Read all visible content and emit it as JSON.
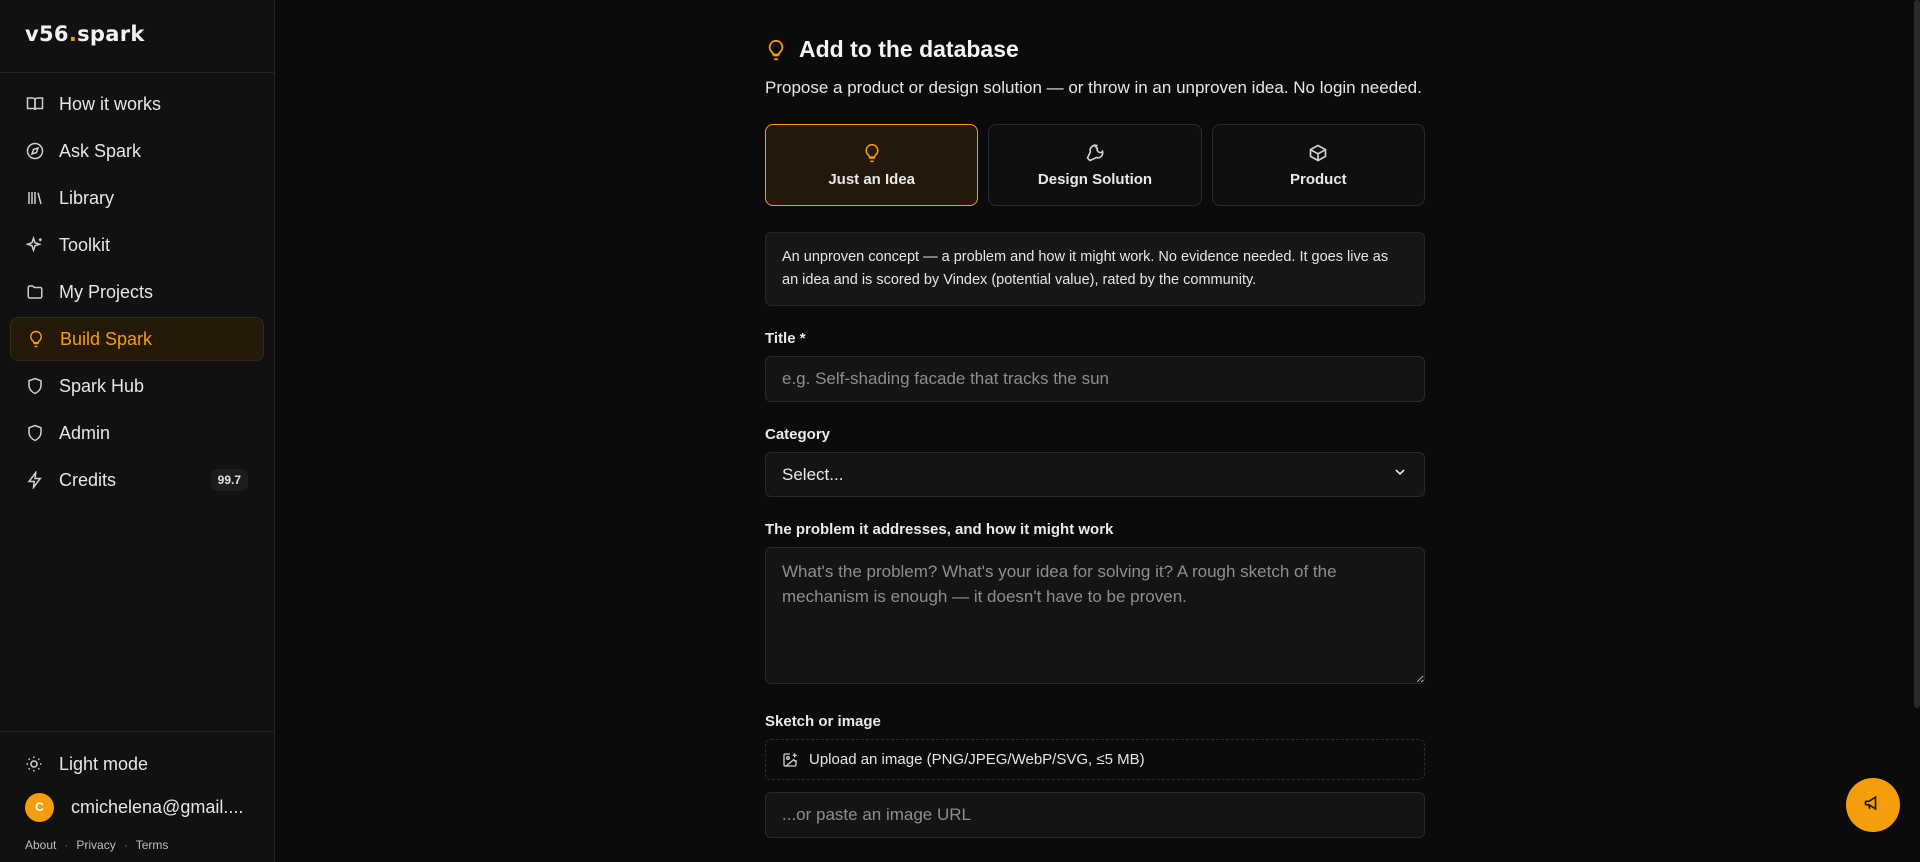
{
  "app": {
    "logo_prefix": "v56",
    "logo_dot": ".",
    "logo_suffix": "spark"
  },
  "sidebar": {
    "items": [
      {
        "label": "How it works",
        "icon": "book-icon"
      },
      {
        "label": "Ask Spark",
        "icon": "compass-icon"
      },
      {
        "label": "Library",
        "icon": "library-icon"
      },
      {
        "label": "Toolkit",
        "icon": "sparkles-icon"
      },
      {
        "label": "My Projects",
        "icon": "folder-icon"
      },
      {
        "label": "Build Spark",
        "icon": "lightbulb-icon",
        "active": true
      },
      {
        "label": "Spark Hub",
        "icon": "shield-icon"
      },
      {
        "label": "Admin",
        "icon": "shield-icon"
      },
      {
        "label": "Credits",
        "icon": "bolt-icon",
        "badge": "99.7"
      }
    ],
    "theme_label": "Light mode",
    "user": {
      "initial": "C",
      "email": "cmichelena@gmail...."
    },
    "footer": [
      "About",
      "Privacy",
      "Terms"
    ]
  },
  "main": {
    "title": "Add to the database",
    "subtitle": "Propose a product or design solution — or throw in an unproven idea. No login needed.",
    "types": [
      {
        "label": "Just an Idea",
        "icon": "lightbulb-icon",
        "active": true
      },
      {
        "label": "Design Solution",
        "icon": "wrench-icon"
      },
      {
        "label": "Product",
        "icon": "box-icon"
      }
    ],
    "info": "An unproven concept — a problem and how it might work. No evidence needed. It goes live as an idea and is scored by Vindex (potential value), rated by the community.",
    "title_field": {
      "label": "Title *",
      "placeholder": "e.g. Self-shading facade that tracks the sun"
    },
    "category_field": {
      "label": "Category",
      "value": "Select..."
    },
    "problem_field": {
      "label": "The problem it addresses, and how it might work",
      "placeholder": "What's the problem? What's your idea for solving it? A rough sketch of the mechanism is enough — it doesn't have to be proven."
    },
    "image_field": {
      "label": "Sketch or image",
      "upload_label": "Upload an image (PNG/JPEG/WebP/SVG, ≤5 MB)",
      "url_placeholder": "...or paste an image URL"
    }
  },
  "colors": {
    "accent": "#f59e0b",
    "background": "#0b0b0b",
    "sidebar": "#111111"
  }
}
